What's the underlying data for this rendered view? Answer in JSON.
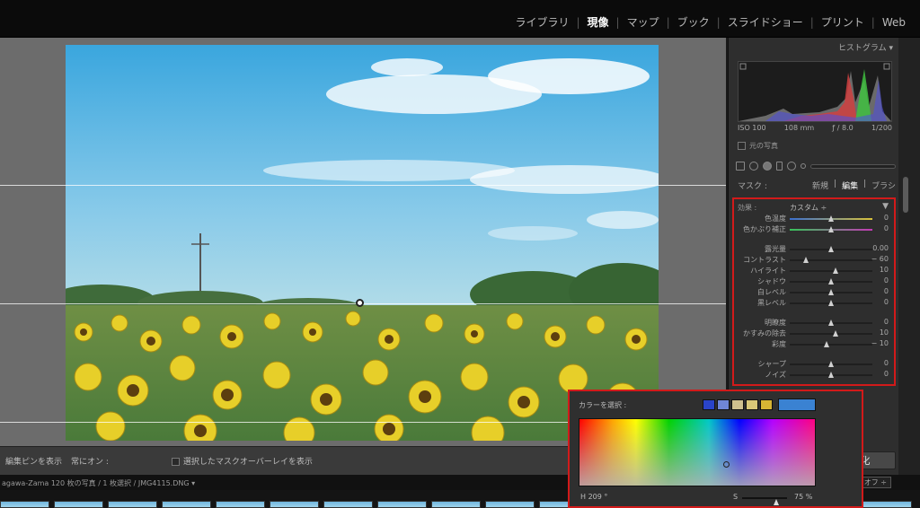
{
  "modules": {
    "library": "ライブラリ",
    "develop": "現像",
    "map": "マップ",
    "book": "ブック",
    "slideshow": "スライドショー",
    "print": "プリント",
    "web": "Web",
    "separator": "|"
  },
  "histogram": {
    "title": "ヒストグラム ▾",
    "iso": "ISO 100",
    "focal": "108 mm",
    "aperture": "ƒ / 8.0",
    "shutter": "1/200",
    "original_photo": "元の写真"
  },
  "mask": {
    "label": "マスク :",
    "new": "新規",
    "edit": "編集",
    "brush": "ブラシ",
    "separator": "|"
  },
  "effects": {
    "label": "効果 :",
    "preset": "カスタム ÷",
    "sliders": [
      {
        "label": "色温度",
        "value": "0",
        "level": 0.5
      },
      {
        "label": "色かぶり補正",
        "value": "0",
        "level": 0.5
      },
      {
        "label": "露光量",
        "value": "0.00",
        "level": 0.5
      },
      {
        "label": "コントラスト",
        "value": "− 60",
        "level": 0.2
      },
      {
        "label": "ハイライト",
        "value": "10",
        "level": 0.55
      },
      {
        "label": "シャドウ",
        "value": "0",
        "level": 0.5
      },
      {
        "label": "白レベル",
        "value": "0",
        "level": 0.5
      },
      {
        "label": "黒レベル",
        "value": "0",
        "level": 0.5
      },
      {
        "label": "明瞭度",
        "value": "0",
        "level": 0.5
      },
      {
        "label": "かすみの除去",
        "value": "10",
        "level": 0.55
      },
      {
        "label": "彩度",
        "value": "− 10",
        "level": 0.45
      },
      {
        "label": "シャープ",
        "value": "0",
        "level": 0.5
      },
      {
        "label": "ノイズ",
        "value": "0",
        "level": 0.5
      }
    ]
  },
  "toolbar": {
    "show_pins": "編集ピンを表示",
    "always_on": "常にオン :",
    "overlay": "選択したマスクオーバーレイを表示"
  },
  "buttons": {
    "reset": "初期化"
  },
  "filmstrip": {
    "info": "agawa-Zama   120 枚の写真 / 1 枚選択 / JMG4115.DNG ▾",
    "filter": "フィルターオフ ÷"
  },
  "picker": {
    "title": "カラーを選択 :",
    "swatches": [
      "#2a44c8",
      "#6f86d6",
      "#cfc18f",
      "#d9c878",
      "#d6b534"
    ],
    "selected": "#3a82d2",
    "h_label": "H",
    "h_value": "209 °",
    "s_label": "S",
    "s_value": "75 %",
    "s_level": 0.75
  }
}
